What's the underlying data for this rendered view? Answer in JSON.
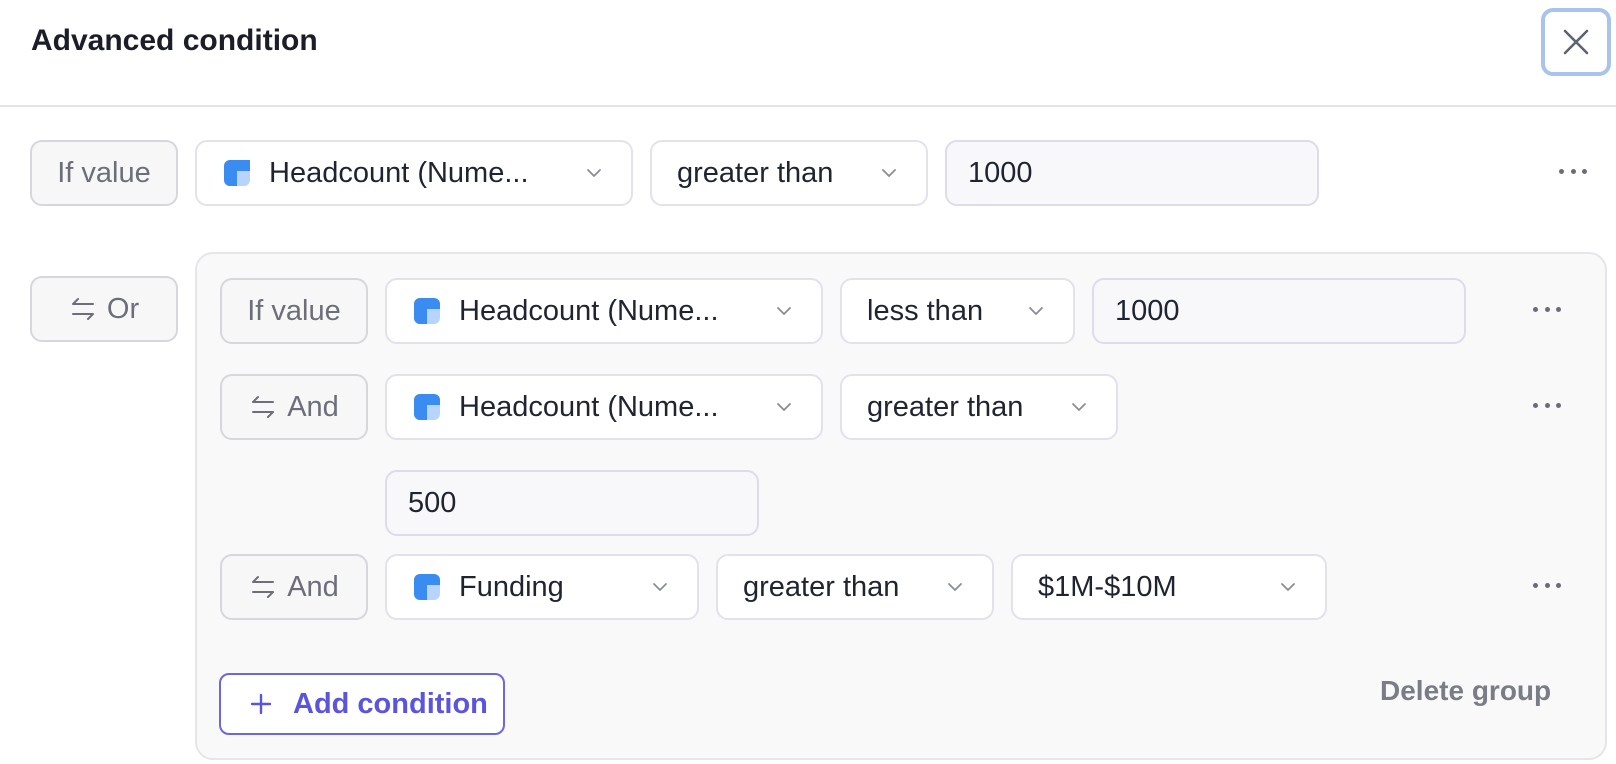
{
  "header": {
    "title": "Advanced condition"
  },
  "first_row": {
    "prefix": "If value",
    "field": "Headcount (Nume...",
    "operator": "greater than",
    "value": "1000"
  },
  "or_label": "Or",
  "group": {
    "rows": [
      {
        "prefix": "If value",
        "field": "Headcount (Nume...",
        "operator": "less than",
        "value": "1000"
      },
      {
        "prefix": "And",
        "field": "Headcount (Nume...",
        "operator": "greater than",
        "value": "500"
      },
      {
        "prefix": "And",
        "field": "Funding",
        "operator": "greater than",
        "value": "$1M-$10M"
      }
    ],
    "add_condition": "Add condition",
    "delete_group": "Delete group"
  },
  "icons": {
    "close": "close-icon",
    "chevron": "chevron-down-icon",
    "field_type": "field-type-icon",
    "logic": "swap-arrows-icon",
    "more": "more-horizontal-icon",
    "plus": "plus-icon"
  },
  "colors": {
    "accent": "#5b55de",
    "field_icon_dark": "#3b8cf0",
    "field_icon_light": "#b8d4fb",
    "focus_ring": "#a8c4ec"
  }
}
